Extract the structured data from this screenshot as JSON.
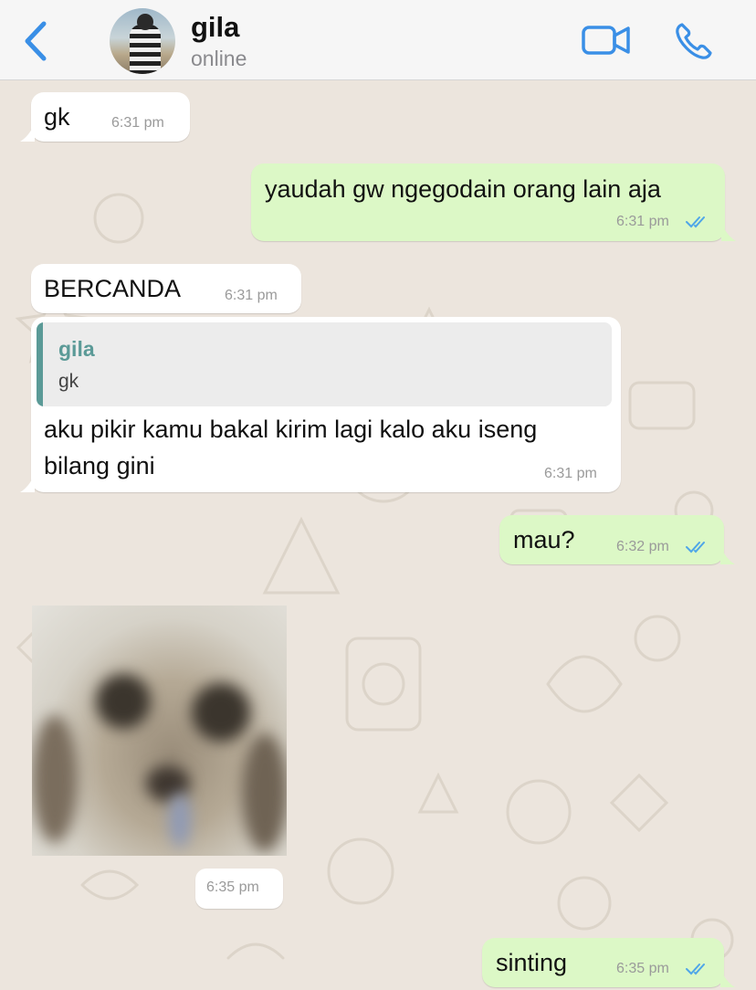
{
  "header": {
    "contact_name": "gila",
    "status": "online",
    "back_icon": "chevron-left-icon",
    "video_icon": "video-camera-icon",
    "call_icon": "phone-icon",
    "accent_color": "#3a8fe6"
  },
  "messages": [
    {
      "direction": "incoming",
      "text": "gk",
      "time": "6:31 pm"
    },
    {
      "direction": "outgoing",
      "text": "yaudah gw ngegodain orang lain aja",
      "time": "6:31 pm",
      "read": true
    },
    {
      "direction": "incoming",
      "text": "BERCANDA",
      "time": "6:31 pm"
    },
    {
      "direction": "incoming",
      "reply_to": {
        "sender": "gila",
        "text": "gk"
      },
      "lines": [
        "aku pikir kamu bakal kirim lagi kalo aku iseng",
        "bilang gini"
      ],
      "time": "6:31 pm"
    },
    {
      "direction": "outgoing",
      "text": "mau?",
      "time": "6:32 pm",
      "read": true
    },
    {
      "direction": "incoming",
      "type": "image",
      "time": "6:35 pm"
    },
    {
      "direction": "outgoing",
      "text": "sinting",
      "time": "6:35 pm",
      "read": true
    }
  ],
  "colors": {
    "incoming_bubble": "#ffffff",
    "outgoing_bubble": "#dcf8c6",
    "chat_background": "#ece5dd",
    "read_ticks": "#4fa6e8"
  }
}
